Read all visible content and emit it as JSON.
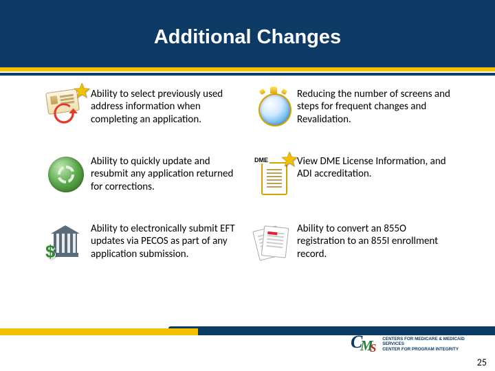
{
  "title": "Additional Changes",
  "items": [
    {
      "text": "Ability to select previously used address information when completing an application."
    },
    {
      "text": "Reducing the number of screens and steps for frequent changes and Revalidation."
    },
    {
      "text": "Ability to quickly update and resubmit any application returned for corrections."
    },
    {
      "text": "View DME License Information, and ADI accreditation.",
      "badge": "DME"
    },
    {
      "text": "Ability to electronically submit EFT updates via PECOS as part of any application submission."
    },
    {
      "text": "Ability to convert an 855O registration to an 855I enrollment record."
    }
  ],
  "logo": {
    "line1": "CENTERS FOR MEDICARE & MEDICAID SERVICES",
    "line2": "CENTER FOR PROGRAM INTEGRITY"
  },
  "page_number": "25"
}
